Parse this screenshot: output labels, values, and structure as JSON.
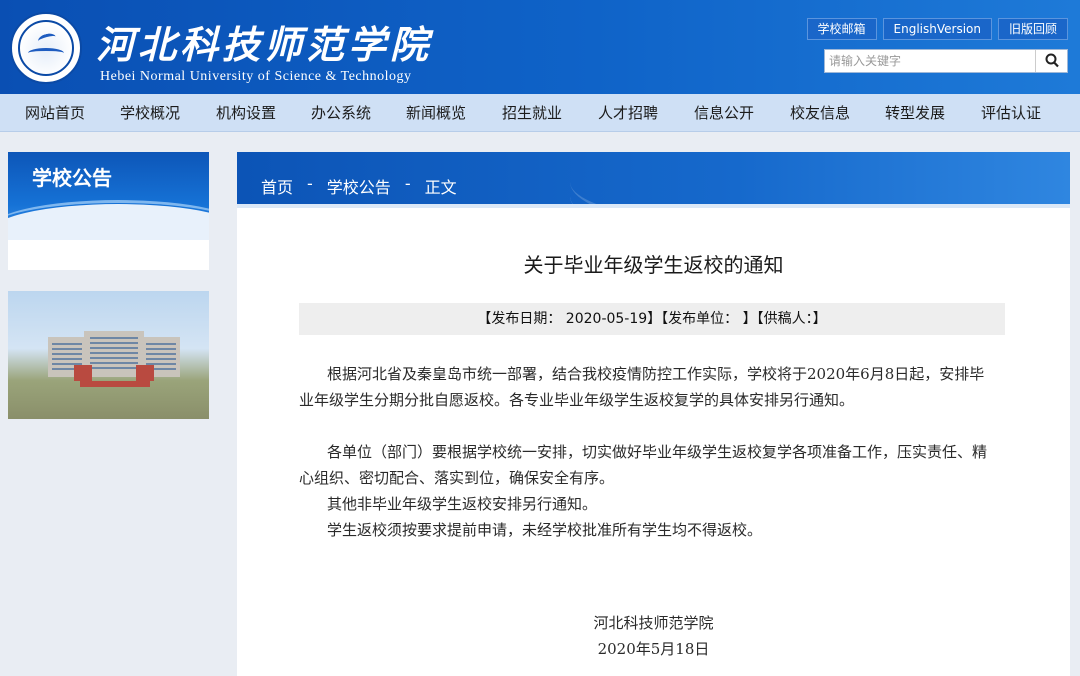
{
  "header": {
    "title": "河北科技师范学院",
    "subtitle": "Hebei Normal University of Science & Technology",
    "top_links": [
      "学校邮箱",
      "EnglishVersion",
      "旧版回顾"
    ],
    "search_placeholder": "请输入关键字",
    "accent_color": "#0f63c8"
  },
  "nav": {
    "items": [
      "网站首页",
      "学校概况",
      "机构设置",
      "办公系统",
      "新闻概览",
      "招生就业",
      "人才招聘",
      "信息公开",
      "校友信息",
      "转型发展",
      "评估认证"
    ]
  },
  "sidebar": {
    "title": "学校公告"
  },
  "breadcrumb": [
    "首页",
    "-",
    "学校公告",
    "-",
    "正文"
  ],
  "article": {
    "title": "关于毕业年级学生返校的通知",
    "meta": "【发布日期： 2020-05-19】【发布单位： 】【供稿人：】",
    "paragraphs": [
      "根据河北省及秦皇岛市统一部署，结合我校疫情防控工作实际，学校将于2020年6月8日起，安排毕业年级学生分期分批自愿返校。各专业毕业年级学生返校复学的具体安排另行通知。",
      "各单位（部门）要根据学校统一安排，切实做好毕业年级学生返校复学各项准备工作，压实责任、精心组织、密切配合、落实到位，确保安全有序。",
      "其他非毕业年级学生返校安排另行通知。",
      "学生返校须按要求提前申请，未经学校批准所有学生均不得返校。"
    ],
    "signature": "河北科技师范学院",
    "date": "2020年5月18日"
  }
}
